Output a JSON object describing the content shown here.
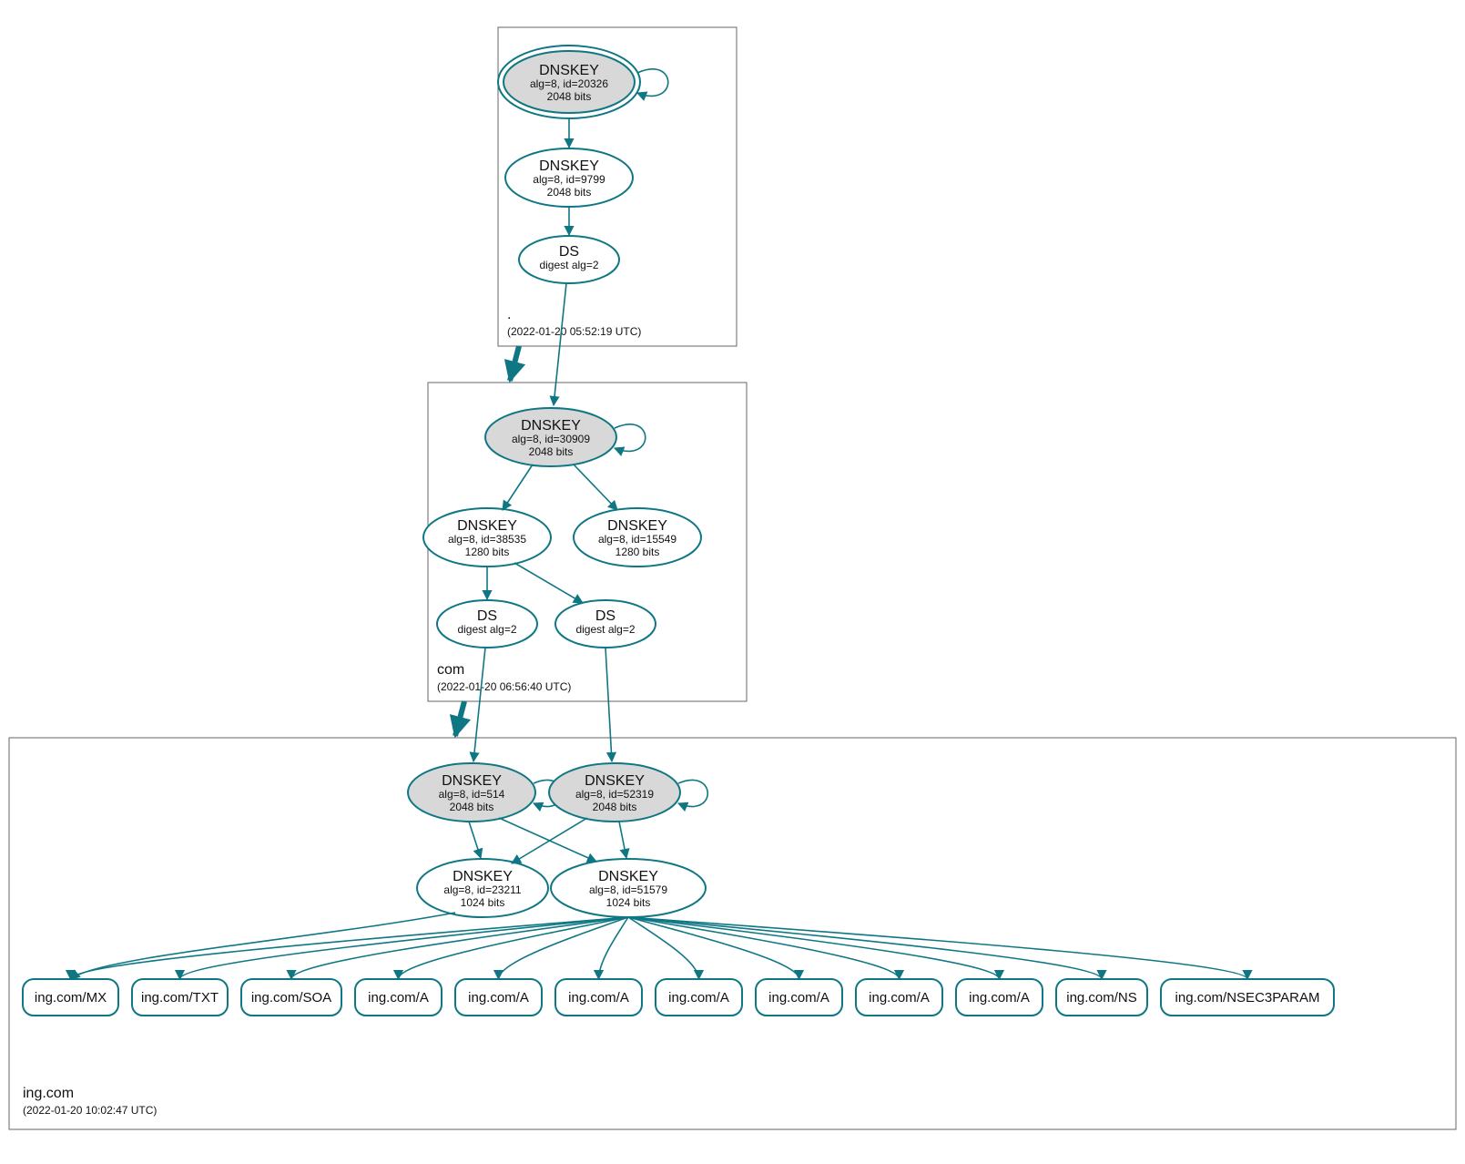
{
  "colors": {
    "stroke": "#0f7784",
    "shaded_fill": "#d8d8d8"
  },
  "zones": {
    "root": {
      "label": ".",
      "timestamp": "(2022-01-20 05:52:19 UTC)"
    },
    "com": {
      "label": "com",
      "timestamp": "(2022-01-20 06:56:40 UTC)"
    },
    "domain": {
      "label": "ing.com",
      "timestamp": "(2022-01-20 10:02:47 UTC)"
    }
  },
  "nodes": {
    "root_ksk": {
      "title": "DNSKEY",
      "sub1": "alg=8, id=20326",
      "sub2": "2048 bits"
    },
    "root_zsk": {
      "title": "DNSKEY",
      "sub1": "alg=8, id=9799",
      "sub2": "2048 bits"
    },
    "root_ds": {
      "title": "DS",
      "sub1": "digest alg=2",
      "sub2": ""
    },
    "com_ksk": {
      "title": "DNSKEY",
      "sub1": "alg=8, id=30909",
      "sub2": "2048 bits"
    },
    "com_zsk1": {
      "title": "DNSKEY",
      "sub1": "alg=8, id=38535",
      "sub2": "1280 bits"
    },
    "com_zsk2": {
      "title": "DNSKEY",
      "sub1": "alg=8, id=15549",
      "sub2": "1280 bits"
    },
    "com_ds1": {
      "title": "DS",
      "sub1": "digest alg=2",
      "sub2": ""
    },
    "com_ds2": {
      "title": "DS",
      "sub1": "digest alg=2",
      "sub2": ""
    },
    "dom_ksk1": {
      "title": "DNSKEY",
      "sub1": "alg=8, id=514",
      "sub2": "2048 bits"
    },
    "dom_ksk2": {
      "title": "DNSKEY",
      "sub1": "alg=8, id=52319",
      "sub2": "2048 bits"
    },
    "dom_zsk1": {
      "title": "DNSKEY",
      "sub1": "alg=8, id=23211",
      "sub2": "1024 bits"
    },
    "dom_zsk2": {
      "title": "DNSKEY",
      "sub1": "alg=8, id=51579",
      "sub2": "1024 bits"
    }
  },
  "leaves": [
    "ing.com/MX",
    "ing.com/TXT",
    "ing.com/SOA",
    "ing.com/A",
    "ing.com/A",
    "ing.com/A",
    "ing.com/A",
    "ing.com/A",
    "ing.com/A",
    "ing.com/A",
    "ing.com/NS",
    "ing.com/NSEC3PARAM"
  ]
}
